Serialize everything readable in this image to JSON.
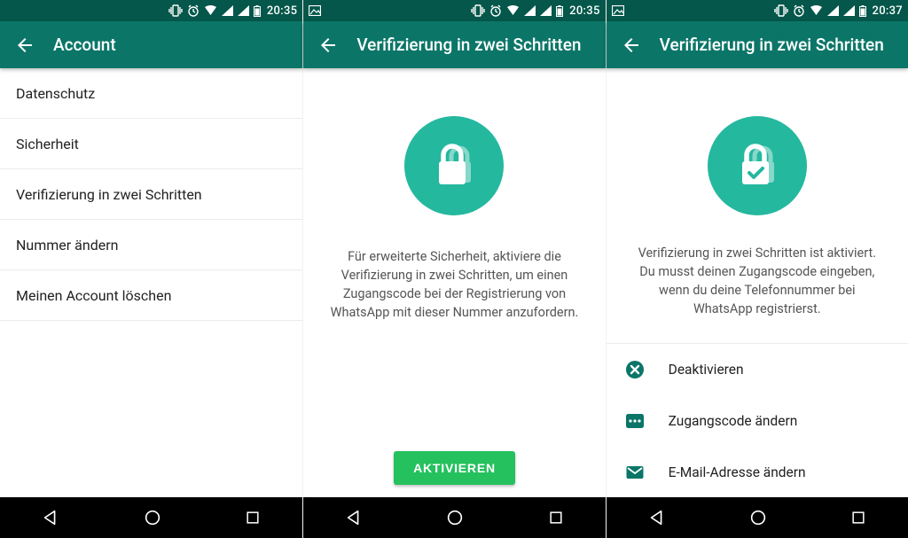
{
  "colors": {
    "teal_dark": "#04574a",
    "teal": "#0b7668",
    "teal_accent": "#24b89f",
    "green_btn": "#24c15e"
  },
  "s1": {
    "status_time": "20:35",
    "title": "Account",
    "items": [
      {
        "label": "Datenschutz"
      },
      {
        "label": "Sicherheit"
      },
      {
        "label": "Verifizierung in zwei Schritten"
      },
      {
        "label": "Nummer ändern"
      },
      {
        "label": "Meinen Account löschen"
      }
    ]
  },
  "s2": {
    "status_time": "20:35",
    "title": "Verifizierung in zwei Schritten",
    "blurb": "Für erweiterte Sicherheit, aktiviere die Verifizierung in zwei Schritten, um einen Zugangscode bei der Registrierung von WhatsApp mit dieser Nummer anzufordern.",
    "button": "AKTIVIEREN"
  },
  "s3": {
    "status_time": "20:37",
    "title": "Verifizierung in zwei Schritten",
    "blurb": "Verifizierung in zwei Schritten ist aktiviert. Du musst deinen Zugangscode eingeben, wenn du deine Telefonnummer bei WhatsApp registrierst.",
    "actions": {
      "deactivate": "Deaktivieren",
      "change_code": "Zugangscode ändern",
      "change_email": "E-Mail-Adresse ändern"
    }
  }
}
